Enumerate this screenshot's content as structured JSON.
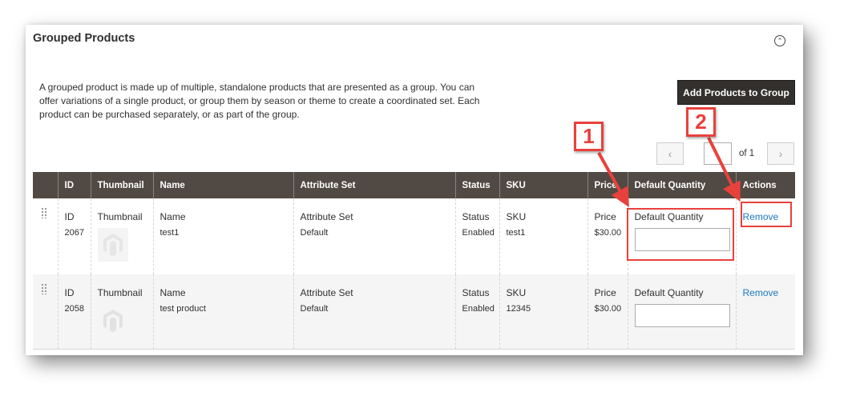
{
  "section": {
    "title": "Grouped Products",
    "collapse_icon": "chevron-up-circle-icon"
  },
  "description": "A grouped product is made up of multiple, standalone products that are presented as a group. You can offer variations of a single product, or group them by season or theme to create a coordinated set. Each product can be purchased separately, or as part of the group.",
  "add_button_label": "Add Products to Group",
  "pager": {
    "prev_icon": "chevron-left-icon",
    "next_icon": "chevron-right-icon",
    "current_page": "",
    "of_label": "of 1"
  },
  "columns": [
    "ID",
    "Thumbnail",
    "Name",
    "Attribute Set",
    "Status",
    "SKU",
    "Price",
    "Default Quantity",
    "Actions"
  ],
  "rows": [
    {
      "id": "2067",
      "name": "test1",
      "attribute_set": "Default",
      "status": "Enabled",
      "sku": "test1",
      "price": "$30.00",
      "default_quantity": "",
      "action": "Remove"
    },
    {
      "id": "2058",
      "name": "test product",
      "attribute_set": "Default",
      "status": "Enabled",
      "sku": "12345",
      "price": "$30.00",
      "default_quantity": "",
      "action": "Remove"
    }
  ],
  "annotations": [
    {
      "number": "1",
      "target": "Default Quantity field"
    },
    {
      "number": "2",
      "target": "Remove link"
    }
  ],
  "colors": {
    "header_bg": "#514943",
    "button_bg": "#33302e",
    "link": "#1979c3",
    "annotation": "#e8413c"
  }
}
